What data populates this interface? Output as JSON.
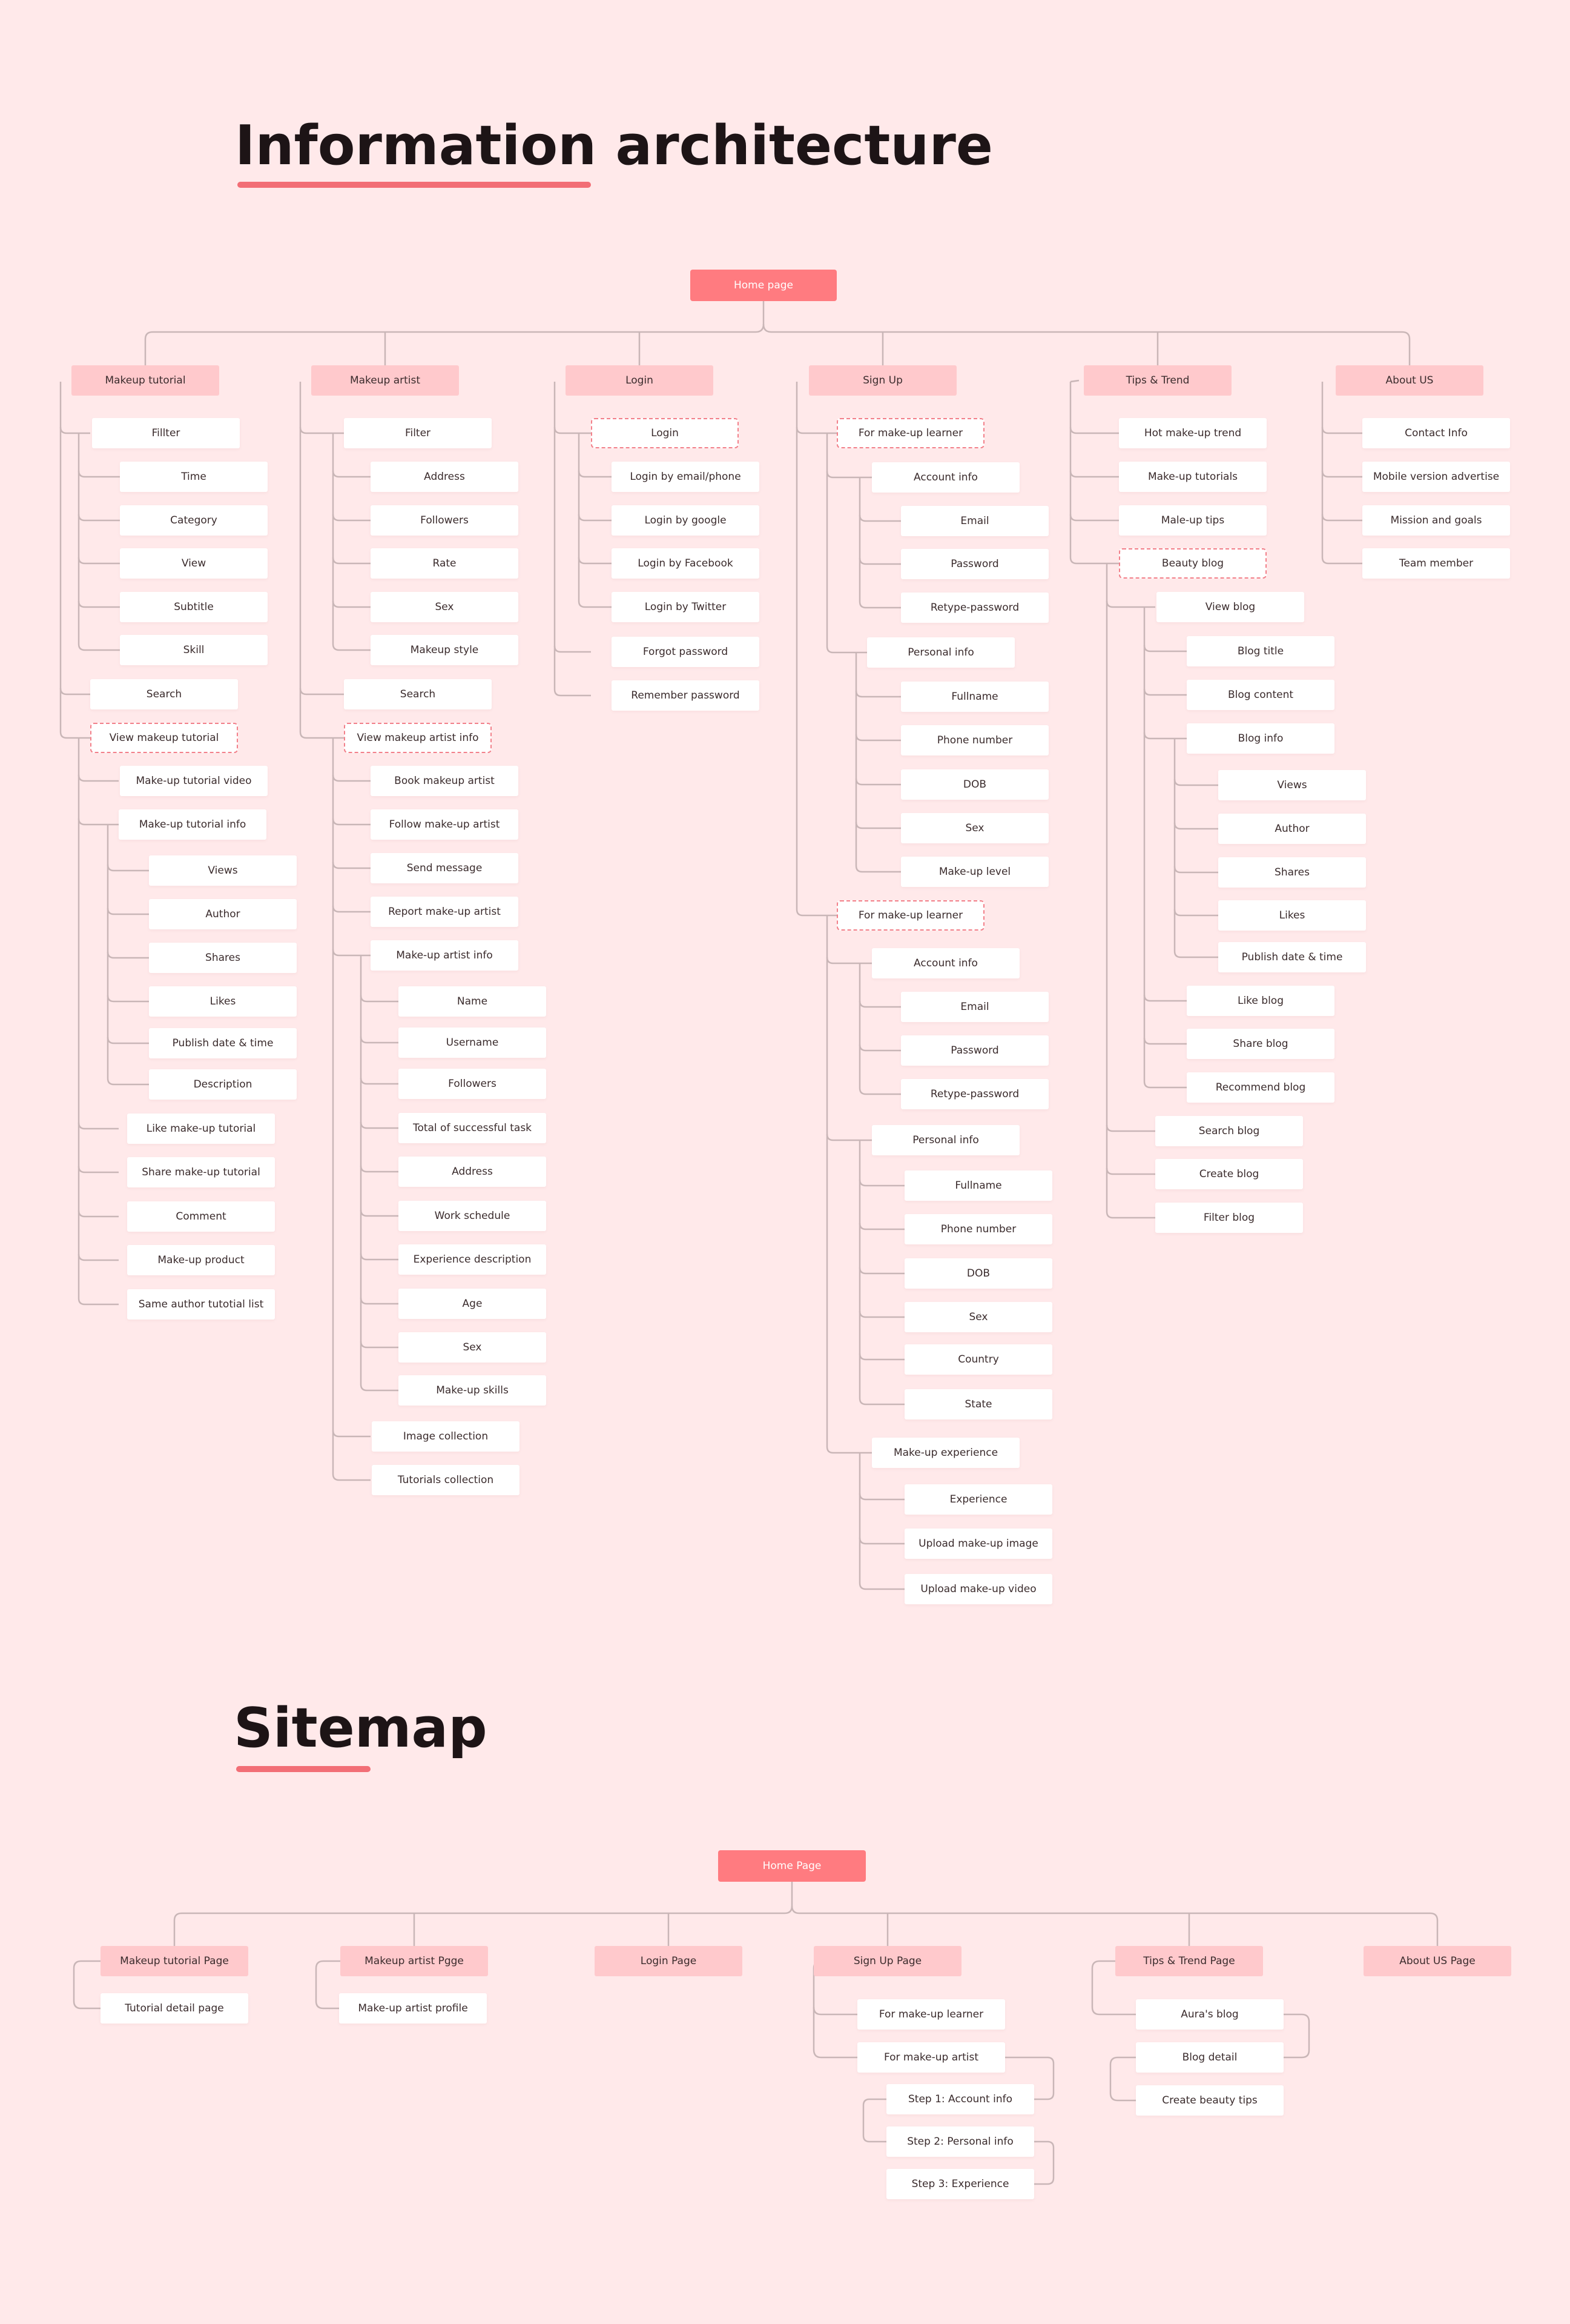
{
  "ia": {
    "title": "Information architecture",
    "home": "Home page",
    "columns": [
      {
        "label": "Makeup tutorial",
        "items": [
          "Fillter",
          "Time",
          "Category",
          "View",
          "Subtitle",
          "Skill",
          "Search",
          "View makeup tutorial",
          "Make-up tutorial video",
          "Make-up tutorial info",
          "Views",
          "Author",
          "Shares",
          "Likes",
          "Publish date & time",
          "Description",
          "Like make-up tutorial",
          "Share make-up tutorial",
          "Comment",
          "Make-up product",
          "Same author tutotial list"
        ]
      },
      {
        "label": "Makeup artist",
        "items": [
          "Filter",
          "Address",
          "Followers",
          "Rate",
          "Sex",
          "Makeup style",
          "Search",
          "View makeup artist info",
          "Book makeup artist",
          "Follow make-up artist",
          "Send message",
          "Report make-up artist",
          "Make-up artist info",
          "Name",
          "Username",
          "Followers",
          "Total of successful task",
          "Address",
          "Work schedule",
          "Experience description",
          "Age",
          "Sex",
          "Make-up skills",
          "Image collection",
          "Tutorials collection"
        ]
      },
      {
        "label": "Login",
        "items": [
          "Login",
          "Login by email/phone",
          "Login by google",
          "Login by Facebook",
          "Login by Twitter",
          "Forgot password",
          "Remember password"
        ]
      },
      {
        "label": "Sign Up",
        "items": [
          "For make-up learner",
          "Account info",
          "Email",
          "Password",
          "Retype-password",
          "Personal info",
          "Fullname",
          "Phone number",
          "DOB",
          "Sex",
          "Make-up level",
          "For make-up learner",
          "Account info",
          "Email",
          "Password",
          "Retype-password",
          "Personal info",
          "Fullname",
          "Phone number",
          "DOB",
          "Sex",
          "Country",
          "State",
          "Make-up experience",
          "Experience",
          "Upload make-up image",
          "Upload make-up video"
        ]
      },
      {
        "label": "Tips & Trend",
        "items": [
          "Hot make-up trend",
          "Make-up tutorials",
          "Male-up tips",
          "Beauty blog",
          "View blog",
          "Blog title",
          "Blog content",
          "Blog info",
          "Views",
          "Author",
          "Shares",
          "Likes",
          "Publish date & time",
          "Like blog",
          "Share blog",
          "Recommend blog",
          "Search blog",
          "Create blog",
          "Filter blog"
        ]
      },
      {
        "label": "About US",
        "items": [
          "Contact Info",
          "Mobile version advertise",
          "Mission and goals",
          "Team member"
        ]
      }
    ]
  },
  "sitemap": {
    "title": "Sitemap",
    "home": "Home Page",
    "columns": [
      {
        "label": "Makeup tutorial Page",
        "items": [
          "Tutorial detail page"
        ]
      },
      {
        "label": "Makeup artist Pgge",
        "items": [
          "Make-up artist profile"
        ]
      },
      {
        "label": "Login Page",
        "items": []
      },
      {
        "label": "Sign Up Page",
        "items": [
          "For make-up learner",
          "For make-up artist",
          "Step 1: Account info",
          "Step 2: Personal info",
          "Step 3: Experience"
        ]
      },
      {
        "label": "Tips & Trend Page",
        "items": [
          "Aura's blog",
          "Blog detail",
          "Create beauty tips"
        ]
      },
      {
        "label": "About US Page",
        "items": []
      }
    ]
  },
  "colors": {
    "background": "#FFE9EA",
    "accent": "#FF7B80",
    "category": "#FFC9CC",
    "connector": "#C9B6B7",
    "dashed_border": "#F2808A",
    "underline": "#F26E76"
  }
}
